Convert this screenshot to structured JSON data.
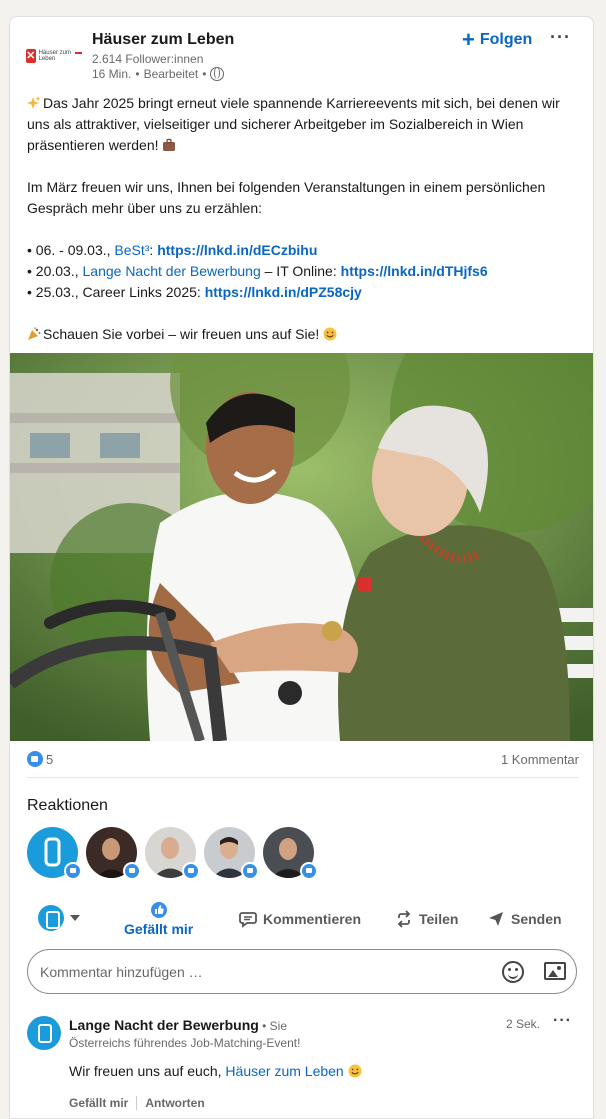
{
  "post": {
    "company_name": "Häuser zum Leben",
    "logo_text": "Häuser zum Leben",
    "followers": "2.614 Follower:innen",
    "time": "16 Min.",
    "edited": "Bearbeitet",
    "follow_label": "Folgen",
    "more_label": "···",
    "paragraph1": "Das Jahr 2025 bringt erneut viele spannende Karriereevents mit sich, bei denen wir uns als attraktiver, vielseitiger und sicherer Arbeitgeber im Sozialbereich in Wien präsentieren werden!",
    "paragraph2": "Im März freuen wir uns, Ihnen bei folgenden Veranstaltungen in einem persönlichen Gespräch mehr über uns zu erzählen:",
    "events": [
      {
        "prefix": "• 06. - 09.03., ",
        "name": "BeSt³",
        "middle": ": ",
        "link": "https://lnkd.in/dECzbihu"
      },
      {
        "prefix": "• 20.03., ",
        "name": "Lange Nacht der Bewerbung",
        "middle": " – IT Online: ",
        "link": "https://lnkd.in/dTHjfs6"
      },
      {
        "prefix": "• 25.03., Career Links 2025: ",
        "name": "",
        "middle": "",
        "link": "https://lnkd.in/dPZ58cjy"
      }
    ],
    "closing": "Schauen Sie vorbei – wir freuen uns auf Sie!"
  },
  "social": {
    "reaction_count": "5",
    "comment_count": "1 Kommentar",
    "reactions_title": "Reaktionen"
  },
  "actions": {
    "like": "Gefällt mir",
    "comment": "Kommentieren",
    "share": "Teilen",
    "send": "Senden"
  },
  "comment_input": {
    "placeholder": "Kommentar hinzufügen …"
  },
  "comment": {
    "author": "Lange Nacht der Bewerbung",
    "author_suffix": " • Sie",
    "headline": "Österreichs führendes Job-Matching-Event!",
    "time": "2 Sek.",
    "text_prefix": "Wir freuen uns auf euch, ",
    "mention": "Häuser zum Leben",
    "like_action": "Gefällt mir",
    "reply_action": "Antworten"
  },
  "colors": {
    "accent": "#0a66c2",
    "like_blue": "#378fe9"
  }
}
